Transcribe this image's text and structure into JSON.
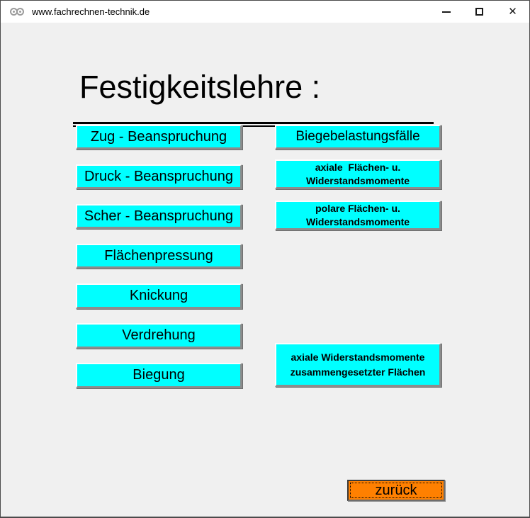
{
  "window": {
    "title": "www.fachrechnen-technik.de",
    "close_glyph": "✕"
  },
  "heading": {
    "title": "Festigkeitslehre :"
  },
  "left_buttons": [
    {
      "label": "Zug - Beanspruchung"
    },
    {
      "label": "Druck - Beanspruchung"
    },
    {
      "label": "Scher - Beanspruchung"
    },
    {
      "label": "Flächenpressung"
    },
    {
      "label": "Knickung"
    },
    {
      "label": "Verdrehung"
    },
    {
      "label": "Biegung"
    }
  ],
  "right_buttons": [
    {
      "label": "Biegebelastungsfälle"
    },
    {
      "lines": [
        "axiale  Flächen- u.",
        "Widerstandsmomente"
      ]
    },
    {
      "lines": [
        "polare Flächen- u.",
        "Widerstandsmomente"
      ]
    },
    {
      "lines": [
        "axiale Widerstandsmomente",
        "zusammengesetzter Flächen"
      ]
    }
  ],
  "back_button": {
    "label": "zurück"
  },
  "colors": {
    "button_bg": "#00FFFF",
    "back_button_bg": "#FF8000",
    "content_bg": "#F0F0F0",
    "titlebar_bg": "#FFFFFF"
  }
}
